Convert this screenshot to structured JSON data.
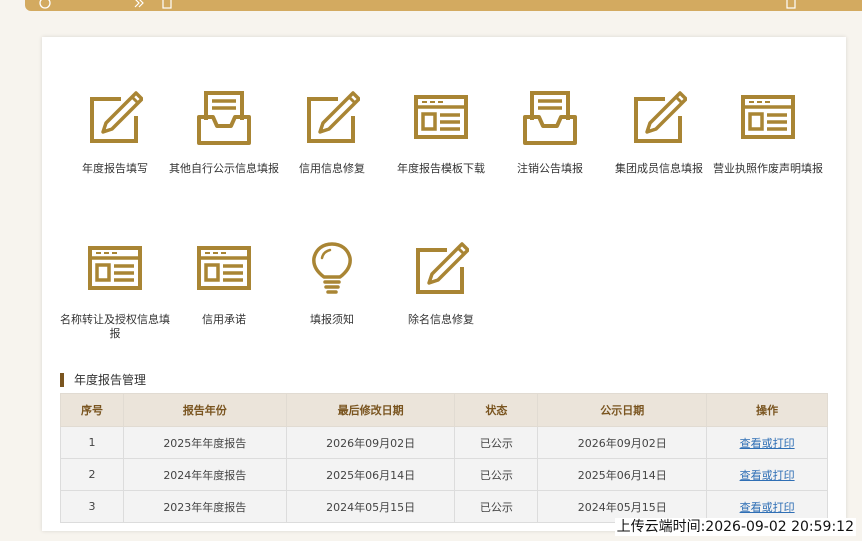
{
  "tiles": [
    {
      "label": "年度报告填写",
      "icon": "edit-pen-icon"
    },
    {
      "label": "其他自行公示信息填报",
      "icon": "inbox-tray-icon"
    },
    {
      "label": "信用信息修复",
      "icon": "edit-pen-icon"
    },
    {
      "label": "年度报告模板下载",
      "icon": "form-window-icon"
    },
    {
      "label": "注销公告填报",
      "icon": "inbox-tray-icon"
    },
    {
      "label": "集团成员信息填报",
      "icon": "edit-pen-icon"
    },
    {
      "label": "营业执照作废声明填报",
      "icon": "form-window-icon"
    },
    {
      "label": "名称转让及授权信息填报",
      "icon": "form-window-icon"
    },
    {
      "label": "信用承诺",
      "icon": "form-window-icon"
    },
    {
      "label": "填报须知",
      "icon": "lightbulb-icon"
    },
    {
      "label": "除名信息修复",
      "icon": "edit-pen-icon"
    }
  ],
  "section": {
    "title": "年度报告管理"
  },
  "table": {
    "headers": [
      "序号",
      "报告年份",
      "最后修改日期",
      "状态",
      "公示日期",
      "操作"
    ],
    "rows": [
      {
        "no": "1",
        "year": "2025年年度报告",
        "modified": "2026年09月02日",
        "status": "已公示",
        "published": "2026年09月02日",
        "action": "查看或打印"
      },
      {
        "no": "2",
        "year": "2024年年度报告",
        "modified": "2025年06月14日",
        "status": "已公示",
        "published": "2025年06月14日",
        "action": "查看或打印"
      },
      {
        "no": "3",
        "year": "2023年年度报告",
        "modified": "2024年05月15日",
        "status": "已公示",
        "published": "2024年05月15日",
        "action": "查看或打印"
      }
    ]
  },
  "upload_stamp": "上传云端时间:2026-09-02 20:59:12",
  "colors": {
    "accent": "#a98534",
    "topbar": "#d3aa60",
    "header_bg": "#ebe4da",
    "header_text": "#7a5520",
    "link": "#2f6fb5"
  }
}
